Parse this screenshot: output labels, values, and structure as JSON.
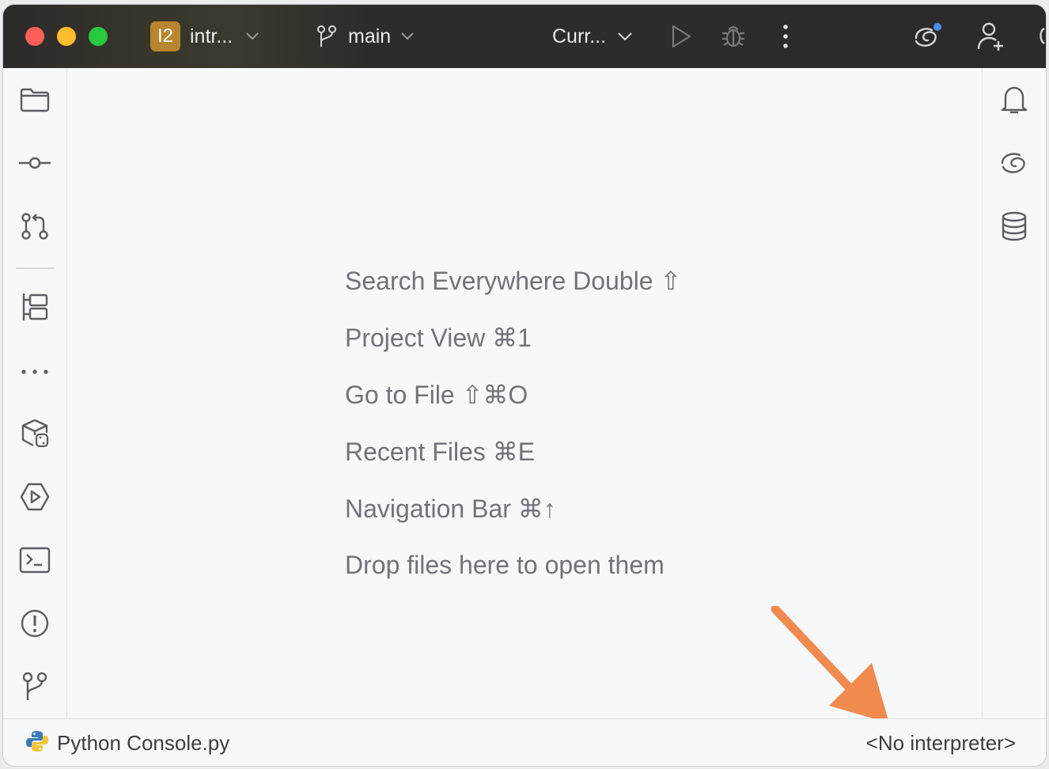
{
  "titlebar": {
    "project_badge": "I2",
    "project_name": "intr...",
    "branch": "main",
    "run_config": "Curr..."
  },
  "left_toolbar": {
    "items": [
      "folder-icon",
      "commit-icon",
      "pull-requests-icon",
      "structure-icon",
      "more-icon",
      "python-packages-icon",
      "services-icon",
      "terminal-icon",
      "problems-icon",
      "git-icon"
    ]
  },
  "right_toolbar": {
    "items": [
      "notifications-icon",
      "ai-assistant-icon",
      "database-icon"
    ]
  },
  "editor": {
    "hints": [
      "Search Everywhere Double ⇧",
      "Project View ⌘1",
      "Go to File ⇧⌘O",
      "Recent Files ⌘E",
      "Navigation Bar ⌘↑",
      "Drop files here to open them"
    ]
  },
  "status_bar": {
    "file": "Python Console.py",
    "interpreter": "<No interpreter>"
  },
  "colors": {
    "titlebar_bg": "#2b2b2b",
    "project_badge": "#b8862e",
    "annotation_arrow": "#f08a4f",
    "hint_text": "#6f737a"
  }
}
